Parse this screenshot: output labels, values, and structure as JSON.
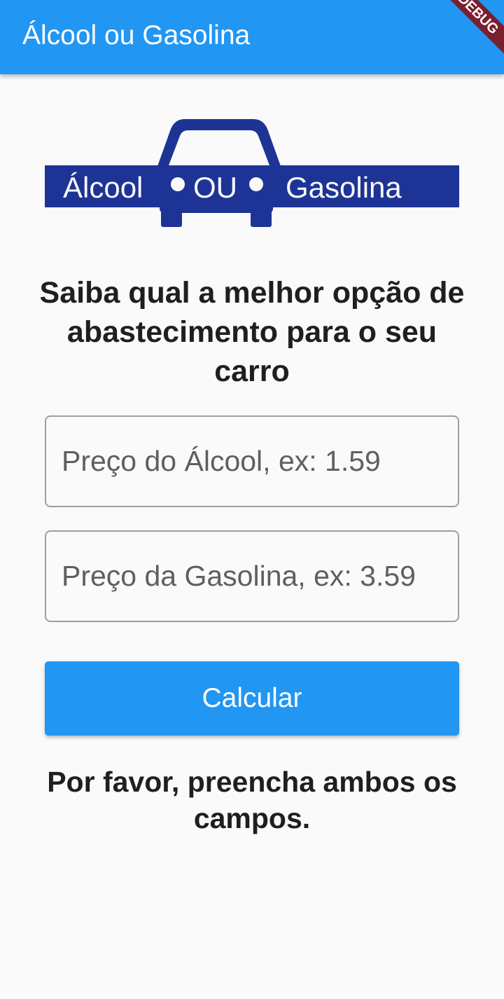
{
  "appbar": {
    "title": "Álcool ou Gasolina",
    "debug_label": "DEBUG",
    "color": "#2196f3"
  },
  "logo": {
    "left_word": "Álcool",
    "middle_word": "OU",
    "right_word": "Gasolina",
    "color": "#1d3496"
  },
  "main": {
    "headline": "Saiba qual a melhor opção de abastecimento para o seu carro",
    "alcool_field": {
      "value": "",
      "placeholder": "Preço do Álcool, ex: 1.59"
    },
    "gasolina_field": {
      "value": "",
      "placeholder": "Preço da Gasolina, ex: 3.59"
    },
    "calculate_label": "Calcular",
    "result_message": "Por favor, preencha ambos os campos."
  }
}
